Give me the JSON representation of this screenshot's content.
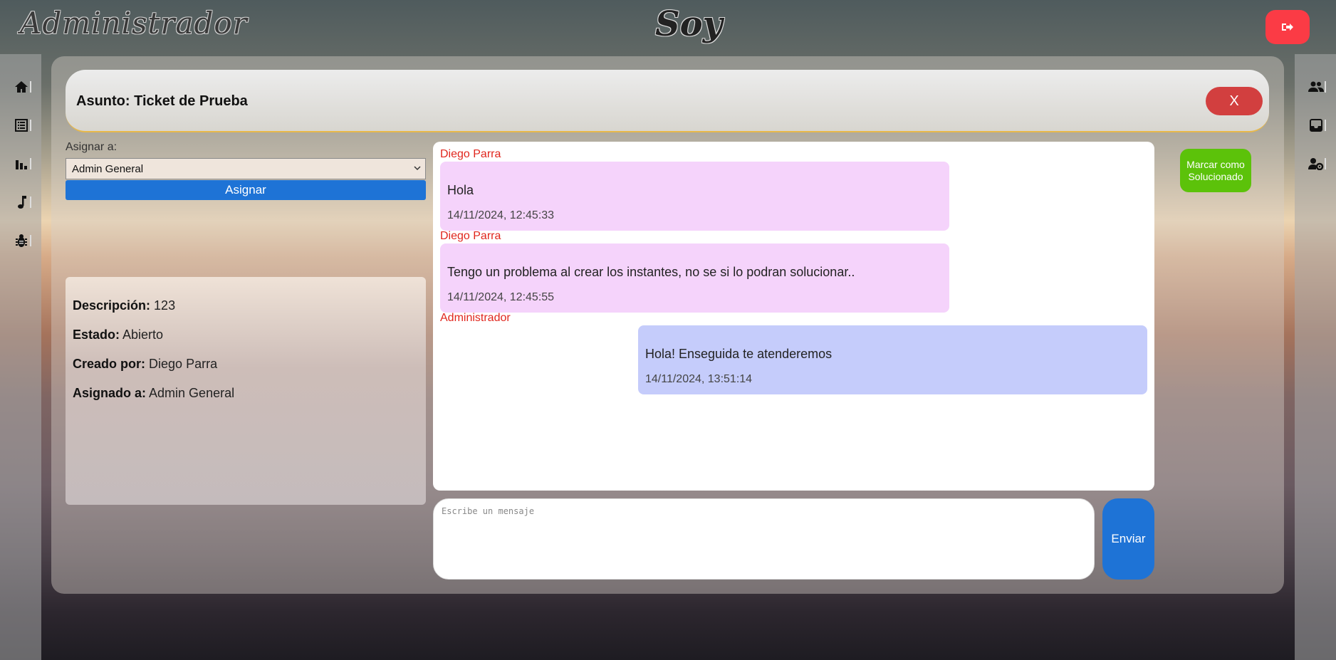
{
  "header": {
    "brand_left": "Administrador",
    "brand_center": "Soy",
    "logout_icon": "sign-out-icon",
    "accent_color": "#fb3b45"
  },
  "sidebar_left": {
    "items": [
      {
        "icon": "home-icon"
      },
      {
        "icon": "list-icon"
      },
      {
        "icon": "bar-chart-icon"
      },
      {
        "icon": "music-note-icon"
      },
      {
        "icon": "bug-icon"
      }
    ]
  },
  "sidebar_right": {
    "items": [
      {
        "icon": "users-icon"
      },
      {
        "icon": "inbox-icon"
      },
      {
        "icon": "user-settings-icon"
      }
    ]
  },
  "ticket": {
    "subject_label": "Asunto: Ticket de Prueba",
    "close_label": "X",
    "assign_label": "Asignar a:",
    "assign_selected": "Admin General",
    "assign_button": "Asignar",
    "mark_solved_button": "Marcar como Solucionado",
    "details": {
      "description_label": "Descripción:",
      "description_value": "123",
      "status_label": "Estado:",
      "status_value": "Abierto",
      "created_by_label": "Creado por:",
      "created_by_value": "Diego Parra",
      "assigned_to_label": "Asignado a:",
      "assigned_to_value": "Admin General"
    }
  },
  "chat": {
    "messages": [
      {
        "author": "Diego Parra",
        "text": "Hola",
        "time": "14/11/2024, 12:45:33",
        "side": "them"
      },
      {
        "author": "Diego Parra",
        "text": "Tengo un problema al crear los instantes, no se si lo podran solucionar..",
        "time": "14/11/2024, 12:45:55",
        "side": "them"
      },
      {
        "author": "Administrador",
        "text": "Hola! Enseguida te atenderemos",
        "time": "14/11/2024, 13:51:14",
        "side": "me"
      }
    ],
    "input_placeholder": "Escribe un mensaje",
    "send_label": "Enviar"
  }
}
